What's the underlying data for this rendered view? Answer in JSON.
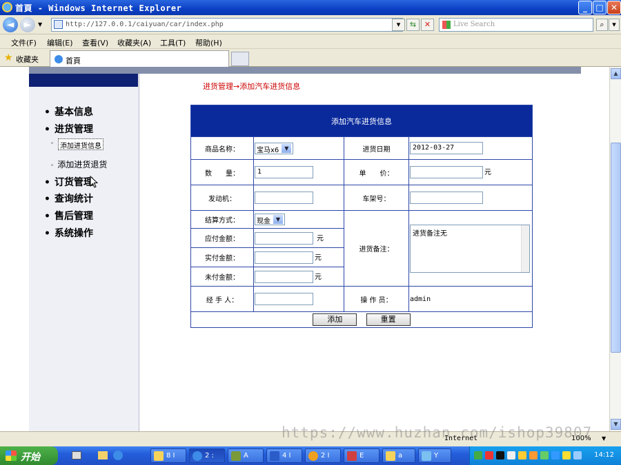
{
  "window": {
    "title": "首頁 - Windows Internet Explorer",
    "url": "http://127.0.0.1/caiyuan/car/index.php",
    "search_placeholder": "Live Search",
    "minimize": "_",
    "maximize": "□",
    "close": "✕"
  },
  "menu": [
    "文件(F)",
    "编辑(E)",
    "查看(V)",
    "收藏夹(A)",
    "工具(T)",
    "帮助(H)"
  ],
  "favorites": {
    "label": "收藏夹",
    "tab_title": "首頁"
  },
  "sidebar": {
    "items": [
      {
        "label": "基本信息"
      },
      {
        "label": "进货管理"
      },
      {
        "label": "订货管理"
      },
      {
        "label": "查询统计"
      },
      {
        "label": "售后管理"
      },
      {
        "label": "系统操作"
      }
    ],
    "subitems": [
      {
        "label": "添加进货信息",
        "selected": true
      },
      {
        "label": "添加进货退货",
        "selected": false
      }
    ]
  },
  "breadcrumb": "进货管理→添加汽车进货信息",
  "form": {
    "title": "添加汽车进货信息",
    "product_name_label": "商品名称：",
    "product_name_value": "宝马x6",
    "purchase_date_label": "进货日期",
    "purchase_date_value": "2012-03-27",
    "quantity_label": "数　　量：",
    "quantity_value": "1",
    "unit_price_label": "单　　价：",
    "unit_price_value": "",
    "yuan": "元",
    "engine_label": "发动机：",
    "engine_value": "",
    "chassis_label": "车架号：",
    "chassis_value": "",
    "payment_method_label": "结算方式：",
    "payment_method_value": "现金",
    "payable_label": "应付金额：",
    "paid_label": "实付金额：",
    "unpaid_label": "未付金额：",
    "remark_label": "进货备注：",
    "remark_value": "进货备注无",
    "handler_label": "经 手 人：",
    "handler_value": "",
    "operator_label": "操 作 员：",
    "operator_value": "admin",
    "add_button": "添加",
    "reset_button": "重置"
  },
  "statusbar": {
    "zone": "Internet",
    "zoom": "100%"
  },
  "watermark": "https://www.huzhan.com/ishop39807",
  "taskbar": {
    "start": "开始",
    "items": [
      "8 I",
      "2 :",
      "A",
      "4 I",
      "2 I",
      "E",
      "a",
      "Y"
    ],
    "clock": "14:12"
  }
}
